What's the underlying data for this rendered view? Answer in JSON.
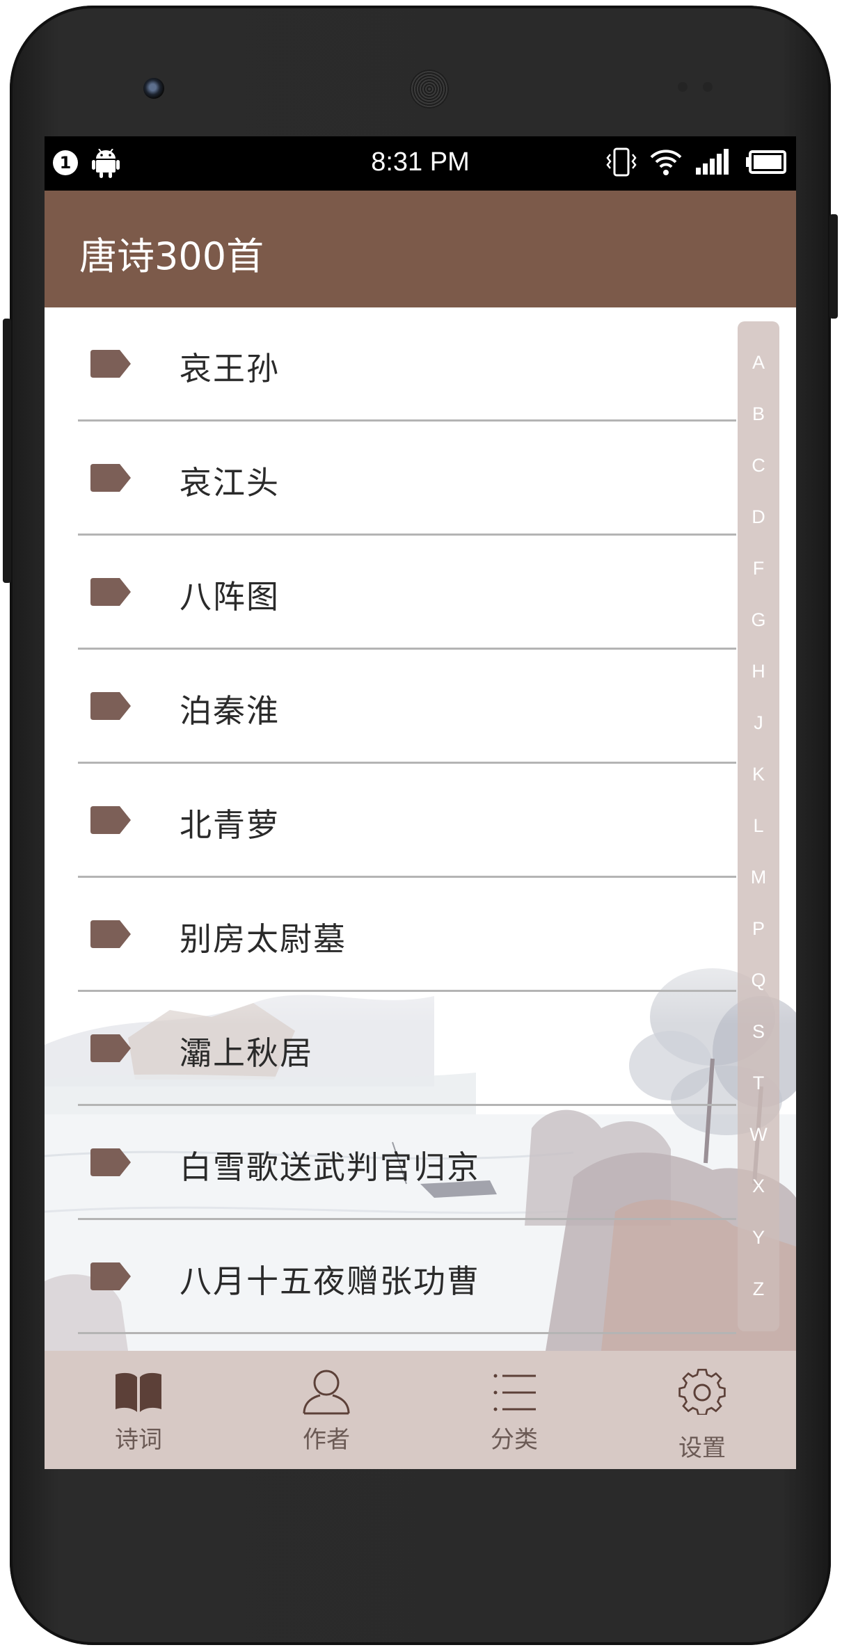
{
  "status_bar": {
    "notification_count": "1",
    "time": "8:31 PM"
  },
  "app_bar": {
    "title": "唐诗300首"
  },
  "poems": [
    {
      "title": "哀王孙"
    },
    {
      "title": "哀江头"
    },
    {
      "title": "八阵图"
    },
    {
      "title": "泊秦淮"
    },
    {
      "title": "北青萝"
    },
    {
      "title": "别房太尉墓"
    },
    {
      "title": "灞上秋居"
    },
    {
      "title": "白雪歌送武判官归京"
    },
    {
      "title": "八月十五夜赠张功曹"
    }
  ],
  "index_letters": [
    "A",
    "B",
    "C",
    "D",
    "F",
    "G",
    "H",
    "J",
    "K",
    "L",
    "M",
    "P",
    "Q",
    "S",
    "T",
    "W",
    "X",
    "Y",
    "Z"
  ],
  "bottom_nav": [
    {
      "label": "诗词",
      "icon": "book-icon"
    },
    {
      "label": "作者",
      "icon": "person-icon"
    },
    {
      "label": "分类",
      "icon": "list-icon"
    },
    {
      "label": "设置",
      "icon": "gear-icon"
    }
  ],
  "colors": {
    "app_bar": "#7c5a4a",
    "tag_icon": "#7c5f57",
    "bottom_nav_bg": "#d7c9c5",
    "nav_icon": "#5c4038",
    "index_bar_bg": "#cdbcb8"
  }
}
